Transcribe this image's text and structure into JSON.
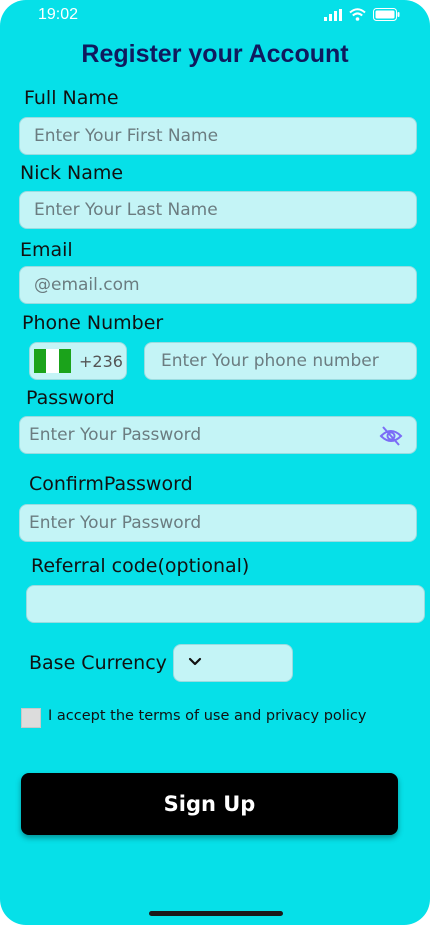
{
  "status_bar": {
    "time": "19:02"
  },
  "title": "Register your Account",
  "fields": {
    "full_name": {
      "label": "Full Name",
      "placeholder": "Enter Your First Name"
    },
    "nick_name": {
      "label": "Nick Name",
      "placeholder": "Enter Your Last Name"
    },
    "email": {
      "label": "Email",
      "placeholder": "@email.com"
    },
    "phone": {
      "label": "Phone Number",
      "country_code": "+236",
      "placeholder": "Enter Your phone number"
    },
    "password": {
      "label": "Password",
      "placeholder": "Enter Your Password"
    },
    "confirm_password": {
      "label": "ConfirmPassword",
      "placeholder": "Enter Your Password"
    },
    "referral": {
      "label": "Referral code(optional)",
      "placeholder": ""
    },
    "base_currency": {
      "label": "Base Currency",
      "selected": ""
    }
  },
  "terms_text": "I accept the terms of use and privacy policy",
  "signup_label": "Sign Up",
  "icons": {
    "flag": "nigeria-flag-icon",
    "password_toggle": "eye-off-icon",
    "dropdown": "chevron-down-icon",
    "status": [
      "signal-icon",
      "wifi-icon",
      "battery-icon"
    ]
  },
  "colors": {
    "background": "#06E0E8",
    "field_fill": "#C4F4F6",
    "title": "#0F1A5E",
    "button": "#000000",
    "eye_icon": "#7B6CF6"
  }
}
